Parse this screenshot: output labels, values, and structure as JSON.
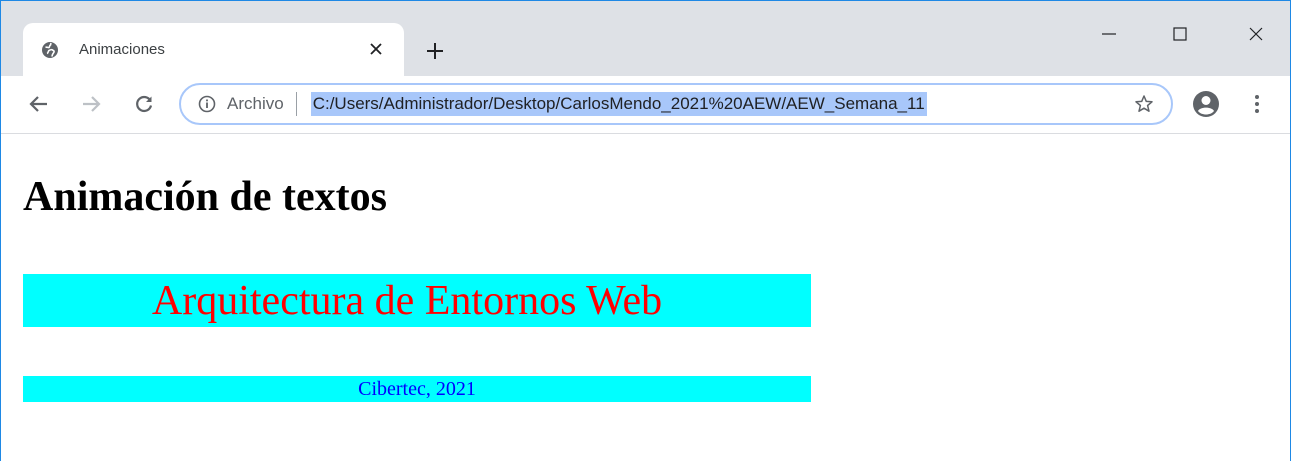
{
  "browser": {
    "tab": {
      "title": "Animaciones"
    },
    "address_bar": {
      "site_label": "Archivo",
      "url": "C:/Users/Administrador/Desktop/CarlosMendo_2021%20AEW/AEW_Semana_11"
    }
  },
  "page": {
    "heading": "Animación de textos",
    "banner_main": "Arquitectura de Entornos Web",
    "banner_sub": "Cibertec, 2021"
  },
  "colors": {
    "banner_background": "#00ffff",
    "banner_main_text": "#ff0000",
    "banner_sub_text": "#0000ff",
    "url_highlight": "#a8c7fa",
    "tabstrip": "#dee1e6"
  },
  "icons": {
    "favicon": "globe-icon",
    "tab_close": "close-icon",
    "new_tab": "plus-icon",
    "minimize": "minimize-icon",
    "maximize": "maximize-icon",
    "window_close": "close-icon",
    "back": "arrow-left-icon",
    "forward": "arrow-right-icon",
    "reload": "reload-icon",
    "site_info": "info-icon",
    "bookmark": "star-icon",
    "profile": "account-icon",
    "menu": "kebab-menu-icon"
  }
}
